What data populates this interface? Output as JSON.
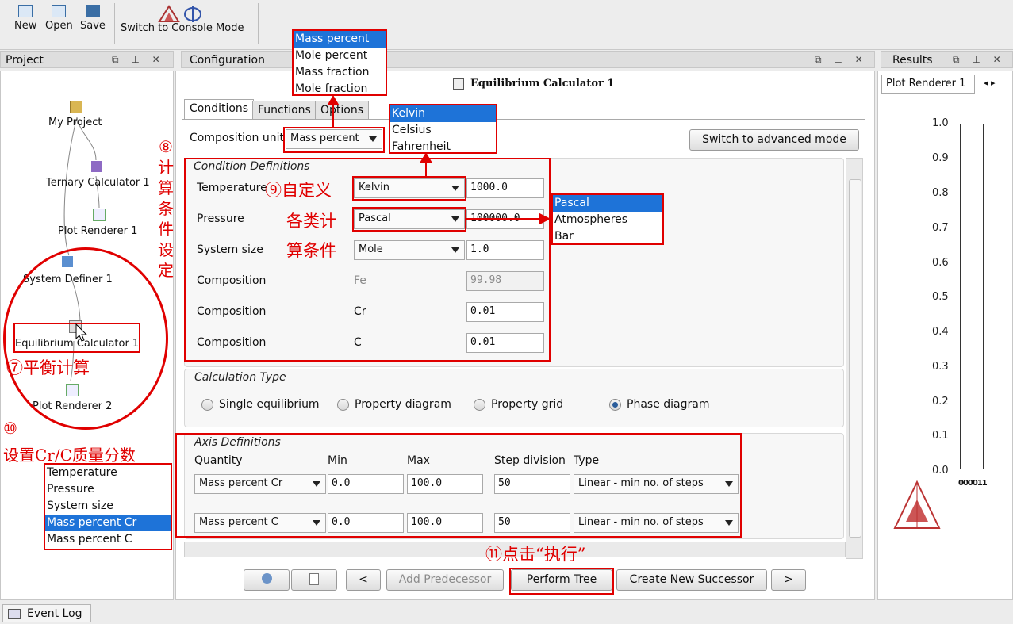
{
  "toolbar": {
    "new": "New",
    "open": "Open",
    "save": "Save",
    "switch": "Switch to Console Mode"
  },
  "project": {
    "title": "Project",
    "nodes": [
      "My Project",
      "Ternary Calculator 1",
      "Plot Renderer 1",
      "System Definer 1",
      "Equilibrium Calculator 1",
      "Plot Renderer 2"
    ]
  },
  "config": {
    "title": "Configuration",
    "header": "Equilibrium Calculator 1",
    "tabs": [
      "Conditions",
      "Functions",
      "Options"
    ],
    "composition_unit_label": "Composition unit",
    "composition_unit_value": "Mass percent",
    "advanced_button": "Switch to advanced mode",
    "condition_section": "Condition Definitions",
    "conditions": [
      {
        "label": "Temperature",
        "unit": "Kelvin",
        "value": "1000.0"
      },
      {
        "label": "Pressure",
        "unit": "Pascal",
        "value": "100000.0"
      },
      {
        "label": "System size",
        "unit": "Mole",
        "value": "1.0"
      },
      {
        "label": "Composition",
        "element": "Fe",
        "value": "99.98"
      },
      {
        "label": "Composition",
        "element": "Cr",
        "value": "0.01"
      },
      {
        "label": "Composition",
        "element": "C",
        "value": "0.01"
      }
    ],
    "calc_section": "Calculation Type",
    "calc_types": [
      "Single equilibrium",
      "Property diagram",
      "Property grid",
      "Phase diagram"
    ],
    "calc_selected": "Phase diagram",
    "axis_section": "Axis Definitions",
    "axis_headers": [
      "Quantity",
      "Min",
      "Max",
      "Step division",
      "Type"
    ],
    "axes": [
      {
        "quantity": "Mass percent Cr",
        "min": "0.0",
        "max": "100.0",
        "step": "50",
        "type": "Linear - min no. of steps"
      },
      {
        "quantity": "Mass percent C",
        "min": "0.0",
        "max": "100.0",
        "step": "50",
        "type": "Linear - min no. of steps"
      }
    ],
    "buttons": {
      "back": "<",
      "add_pred": "Add Predecessor",
      "perform": "Perform Tree",
      "create": "Create New Successor",
      "next": ">"
    }
  },
  "popups": {
    "composition_units": [
      "Mass percent",
      "Mole percent",
      "Mass fraction",
      "Mole fraction"
    ],
    "temperature_units": [
      "Kelvin",
      "Celsius",
      "Fahrenheit"
    ],
    "pressure_units": [
      "Pascal",
      "Atmospheres",
      "Bar"
    ],
    "axis_quantities": [
      "Temperature",
      "Pressure",
      "System size",
      "Mass percent Cr",
      "Mass percent C"
    ]
  },
  "results": {
    "title": "Results",
    "tab": "Plot Renderer 1",
    "yticks": [
      "1.0",
      "0.9",
      "0.8",
      "0.7",
      "0.6",
      "0.5",
      "0.4",
      "0.3",
      "0.2",
      "0.1",
      "0.0"
    ],
    "xtick_stub": "000011"
  },
  "annotations": {
    "a7": "⑦平衡计算",
    "a8": [
      "⑧",
      "计",
      "算",
      "条",
      "件",
      "设",
      "定"
    ],
    "a9_line1": "⑨自定义",
    "a9_line2": "各类计",
    "a9_line3": "算条件",
    "a10_num": "⑩",
    "a10_text": "设置Cr/C质量分数",
    "a11": "⑪点击“执行”"
  },
  "statusbar": {
    "event_log": "Event Log"
  },
  "colors": {
    "annotation": "#e00000",
    "selection": "#1e73d8"
  }
}
